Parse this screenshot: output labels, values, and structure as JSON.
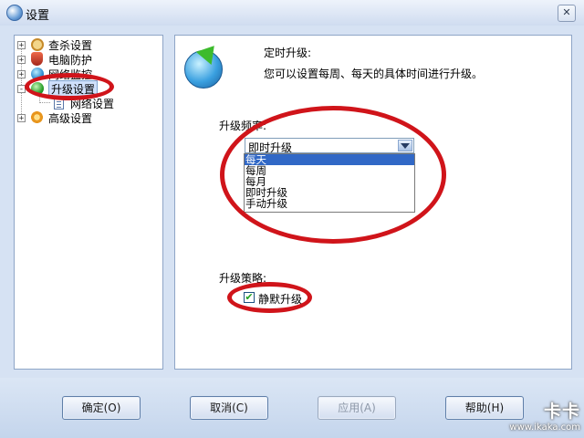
{
  "window": {
    "title": "设置",
    "close_symbol": "✕"
  },
  "tree": {
    "items": [
      {
        "label": "查杀设置",
        "icon": "search-icon",
        "expander": "+"
      },
      {
        "label": "电脑防护",
        "icon": "shield-icon",
        "expander": "+"
      },
      {
        "label": "网络监控",
        "icon": "globe-icon",
        "expander": "+"
      },
      {
        "label": "升级设置",
        "icon": "upgrade-icon",
        "expander": "-",
        "selected": true
      },
      {
        "label": "网络设置",
        "icon": "document-icon"
      },
      {
        "label": "高级设置",
        "icon": "gear-icon",
        "expander": "+"
      }
    ]
  },
  "content": {
    "heading": "定时升级:",
    "description": "您可以设置每周、每天的具体时间进行升级。",
    "frequency_label": "升级频率:",
    "frequency_value": "即时升级",
    "frequency_options": [
      "每天",
      "每周",
      "每月",
      "即时升级",
      "手动升级"
    ],
    "strategy_label": "升级策略:",
    "silent_upgrade_label": "静默升级",
    "silent_upgrade_checked": true
  },
  "buttons": {
    "ok": "确定(O)",
    "cancel": "取消(C)",
    "apply": "应用(A)",
    "help": "帮助(H)"
  },
  "watermark": {
    "brand": "卡卡",
    "url": "www.ikaka.com"
  },
  "colors": {
    "annotation": "#d0141a",
    "selection": "#3168c6"
  }
}
